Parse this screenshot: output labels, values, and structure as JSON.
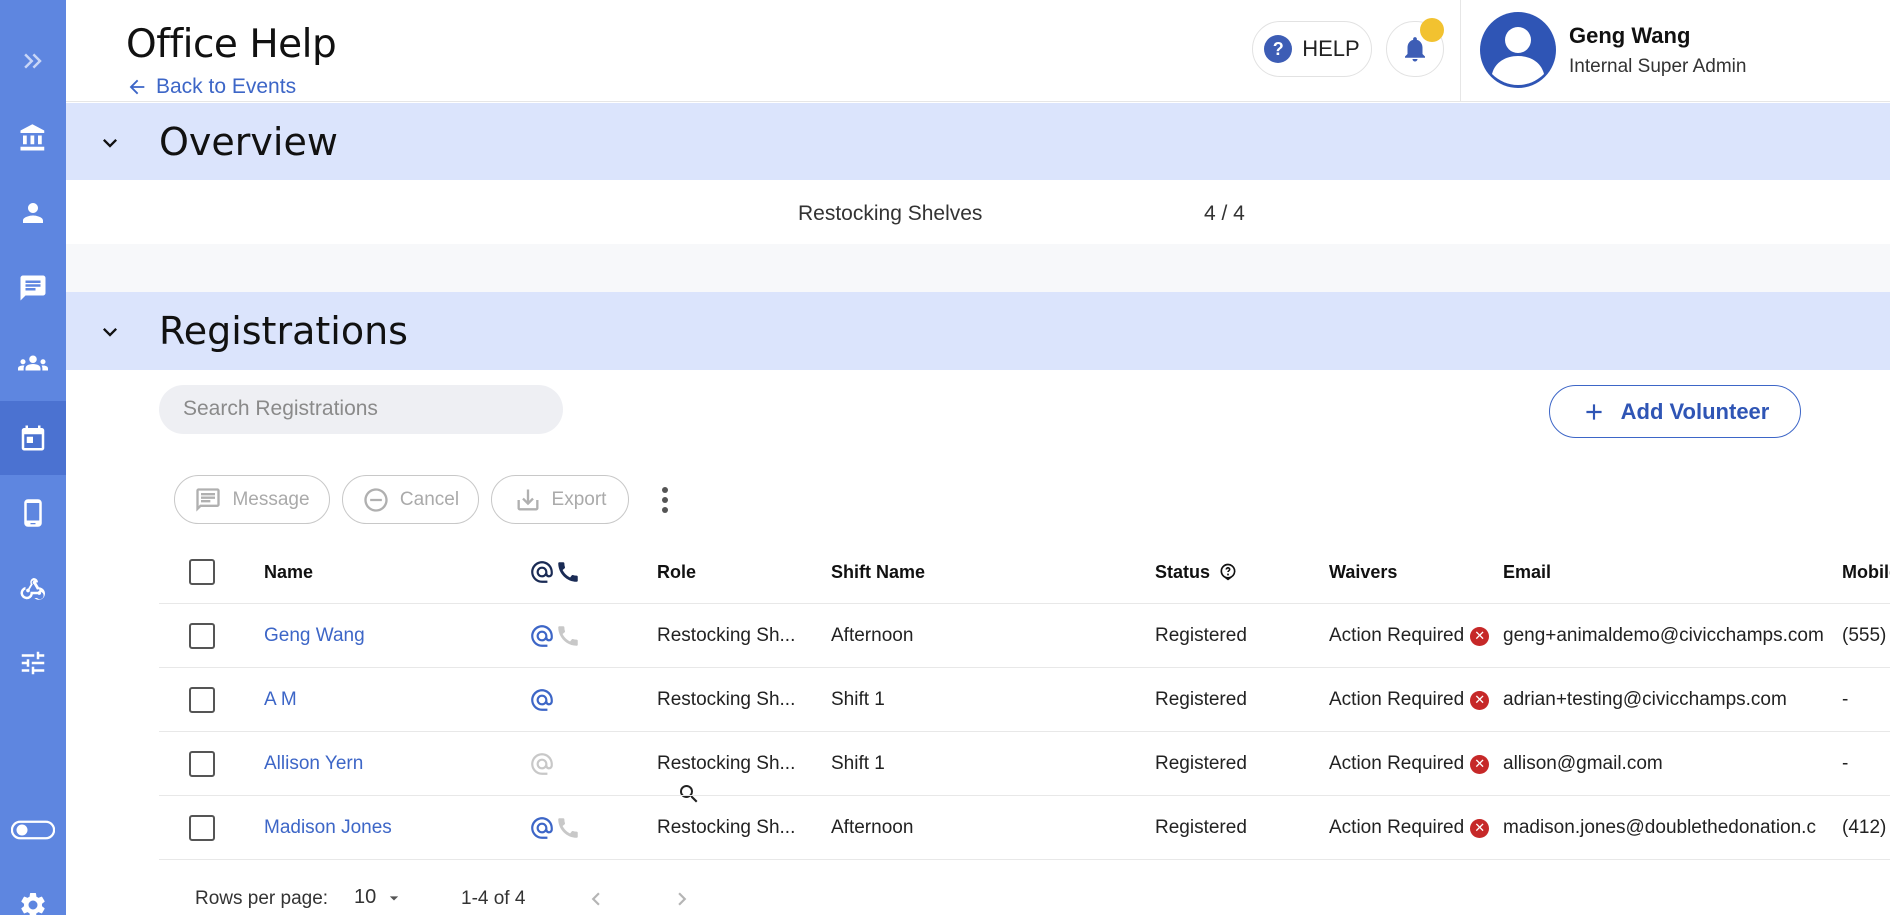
{
  "colors": {
    "sidebar": "#5e86e0",
    "sidebar_active": "#4b72d1",
    "section_bar": "#dbe4fc",
    "accent": "#3d66c7",
    "error": "#c62828",
    "notification": "#f2c230"
  },
  "sidebar": {
    "items": [
      {
        "name": "expand",
        "icon": "double-chevron-right-icon"
      },
      {
        "name": "organization",
        "icon": "bank-icon"
      },
      {
        "name": "people",
        "icon": "person-icon"
      },
      {
        "name": "messages",
        "icon": "chat-icon"
      },
      {
        "name": "groups",
        "icon": "group-icon"
      },
      {
        "name": "events",
        "icon": "calendar-icon",
        "active": true
      },
      {
        "name": "mobile",
        "icon": "mobile-icon"
      },
      {
        "name": "integrations",
        "icon": "webhook-icon"
      },
      {
        "name": "settings-tune",
        "icon": "sliders-icon"
      },
      {
        "name": "theme-toggle",
        "icon": "toggle-icon"
      },
      {
        "name": "settings",
        "icon": "gear-icon"
      }
    ]
  },
  "header": {
    "title": "Office Help",
    "back_label": "Back to Events",
    "help_label": "HELP",
    "user_name": "Geng Wang",
    "user_role": "Internal Super Admin"
  },
  "overview": {
    "title": "Overview",
    "role_name": "Restocking Shelves",
    "role_count": "4 / 4"
  },
  "registrations": {
    "title": "Registrations",
    "search_placeholder": "Search Registrations",
    "add_volunteer_label": "Add Volunteer",
    "toolbar": {
      "message_label": "Message",
      "cancel_label": "Cancel",
      "export_label": "Export"
    },
    "columns": {
      "name": "Name",
      "role": "Role",
      "shift": "Shift Name",
      "status": "Status",
      "waivers": "Waivers",
      "email": "Email",
      "mobile": "Mobile"
    },
    "rows": [
      {
        "name": "Geng Wang",
        "contact": "email+phone",
        "role": "Restocking Sh...",
        "shift": "Afternoon",
        "status": "Registered",
        "waivers": "Action Required",
        "email": "geng+animaldemo@civicchamps.com",
        "mobile": "(555)"
      },
      {
        "name": "A M",
        "contact": "email",
        "role": "Restocking Sh...",
        "shift": "Shift 1",
        "status": "Registered",
        "waivers": "Action Required",
        "email": "adrian+testing@civicchamps.com",
        "mobile": "-"
      },
      {
        "name": "Allison Yern",
        "contact": "email-disabled",
        "role": "Restocking Sh...",
        "shift": "Shift 1",
        "status": "Registered",
        "waivers": "Action Required",
        "email": "allison@gmail.com",
        "mobile": "-"
      },
      {
        "name": "Madison Jones",
        "contact": "email+phone",
        "role": "Restocking Sh...",
        "shift": "Afternoon",
        "status": "Registered",
        "waivers": "Action Required",
        "email": "madison.jones@doublethedonation.c",
        "mobile": "(412)"
      }
    ],
    "pagination": {
      "rows_per_page_label": "Rows per page:",
      "rows_per_page": "10",
      "range": "1-4 of 4"
    }
  }
}
